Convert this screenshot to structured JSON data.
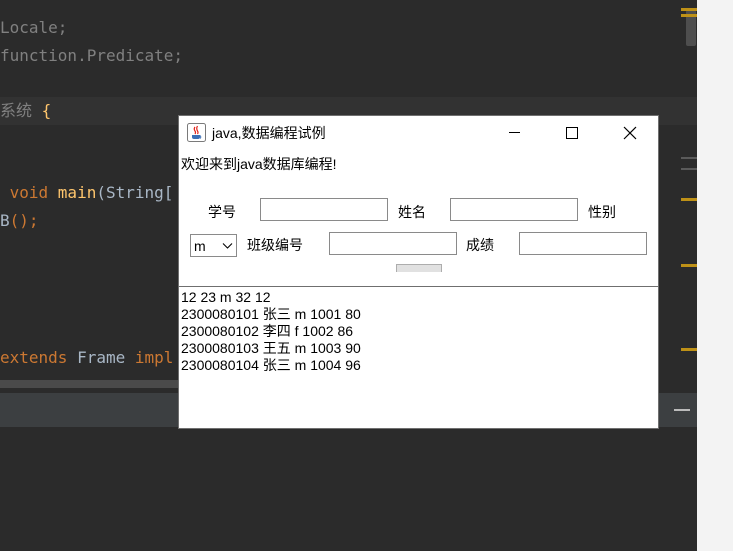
{
  "ide": {
    "code_lines": [
      {
        "segments": [
          {
            "t": "Locale;",
            "c": "dim"
          }
        ]
      },
      {
        "segments": [
          {
            "t": "function.Predicate;",
            "c": "dim"
          }
        ]
      },
      {
        "segments": [
          {
            "t": "系统 ",
            "c": "dim"
          },
          {
            "t": "{",
            "c": "fn"
          }
        ]
      },
      {
        "segments": [
          {
            "t": " void ",
            "c": "kw"
          },
          {
            "t": "main",
            "c": "fn"
          },
          {
            "t": "(String[",
            "c": ""
          }
        ]
      },
      {
        "segments": [
          {
            "t": "B",
            "c": ""
          },
          {
            "t": "();",
            "c": "kw"
          }
        ]
      },
      {
        "segments": [
          {
            "t": "extends ",
            "c": "kw"
          },
          {
            "t": "Frame ",
            "c": ""
          },
          {
            "t": "impl",
            "c": "kw"
          }
        ]
      }
    ]
  },
  "window": {
    "title": "java,数据编程试例",
    "welcome": "欢迎来到java数据库编程!",
    "labels": {
      "student_id": "学号",
      "name": "姓名",
      "gender": "性别",
      "class_id": "班级编号",
      "score": "成绩"
    },
    "fields": {
      "student_id": "",
      "name": "",
      "class_id": "",
      "score": ""
    },
    "gender_choice": "m",
    "records": [
      "12 23 m 32 12",
      "2300080101 张三 m 1001 80",
      "2300080102 李四 f 1002 86",
      "2300080103 王五 m 1003 90",
      "2300080104 张三 m 1004 96"
    ]
  },
  "colors": {
    "ide_background": "#2b2b2b",
    "keyword": "#cc7832",
    "function": "#ffc66d",
    "warning_stripe": "#be9117"
  }
}
